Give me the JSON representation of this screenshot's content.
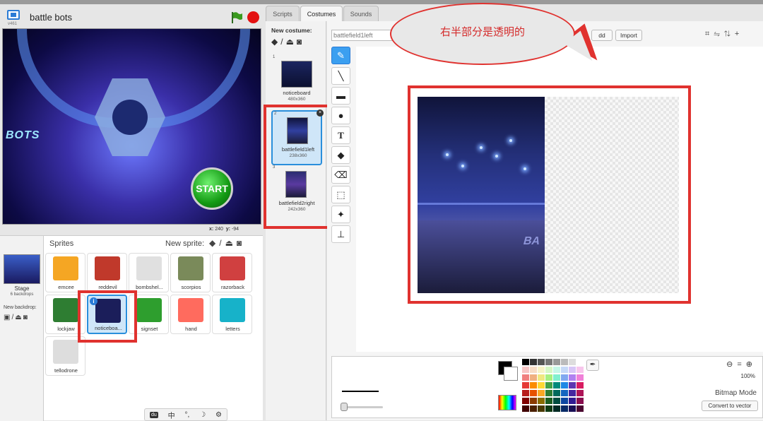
{
  "stage": {
    "project_title": "battle  bots",
    "version": "v461",
    "start_label": "START",
    "bots_text": "BOTS",
    "coords": {
      "x_label": "x:",
      "x": "240",
      "y_label": "y:",
      "y": "-94"
    }
  },
  "sprites_panel": {
    "title": "Sprites",
    "new_sprite_label": "New sprite:",
    "stage_label": "Stage",
    "stage_sub": "6 backdrops",
    "new_backdrop_label": "New backdrop:",
    "sprites": [
      {
        "name": "emcee",
        "color": "#f5a623"
      },
      {
        "name": "reddevil",
        "color": "#c0392b"
      },
      {
        "name": "bombshel...",
        "color": "#e0e0e0"
      },
      {
        "name": "scorpios",
        "color": "#7a8a5a"
      },
      {
        "name": "razorback",
        "color": "#d04040"
      },
      {
        "name": "lockjaw",
        "color": "#2e7d32"
      },
      {
        "name": "noticeboa...",
        "color": "#1b1e5a"
      },
      {
        "name": "signset",
        "color": "#2e9e2e"
      },
      {
        "name": "hand",
        "color": "#ff6b5e"
      },
      {
        "name": "letters",
        "color": "#17b2c9"
      },
      {
        "name": "tellodrone",
        "color": "#dddddd"
      }
    ],
    "ime": [
      "中",
      "°,",
      "☽",
      "⚙"
    ]
  },
  "tabs": [
    "Scripts",
    "Costumes",
    "Sounds"
  ],
  "costumes": {
    "new_costume_label": "New costume:",
    "items": [
      {
        "num": "1",
        "name": "noticeboard",
        "size": "480x360"
      },
      {
        "num": "2",
        "name": "battlefield1left",
        "size": "238x360"
      },
      {
        "num": "3",
        "name": "battlefield2right",
        "size": "242x360"
      }
    ]
  },
  "editor": {
    "costume_name": "battlefield1left",
    "add_label": "dd",
    "import_label": "Import",
    "zoom": "100%",
    "mode": "Bitmap Mode",
    "convert_label": "Convert to vector",
    "arena_text": "BA"
  },
  "annotation": {
    "text": "右半部分是透明的",
    "color": "#e0322f"
  },
  "palette": [
    "#000000",
    "#333333",
    "#555555",
    "#777777",
    "#999999",
    "#bbbbbb",
    "#dddddd",
    "#ffffff",
    "#f7c6c6",
    "#f7dcc6",
    "#f7f3c6",
    "#d6f7c6",
    "#c6f7e8",
    "#c6d9f7",
    "#d8c6f7",
    "#f7c6ec",
    "#f08080",
    "#f0b080",
    "#f0e880",
    "#a8f080",
    "#80f0cf",
    "#80a8f0",
    "#b080f0",
    "#f080d8",
    "#e53935",
    "#fb8c00",
    "#fdd835",
    "#43a047",
    "#00897b",
    "#1e88e5",
    "#5e35b1",
    "#d81b60",
    "#b71c1c",
    "#e65100",
    "#f9a825",
    "#2e7d32",
    "#00695c",
    "#1565c0",
    "#4527a0",
    "#ad1457",
    "#7f0000",
    "#8a3a00",
    "#8a6d00",
    "#1b5e20",
    "#004d40",
    "#0d47a1",
    "#311b92",
    "#880e4f",
    "#400000",
    "#4a2000",
    "#4a3a00",
    "#0f3a12",
    "#002a24",
    "#082a66",
    "#1a0f55",
    "#4a0730"
  ]
}
